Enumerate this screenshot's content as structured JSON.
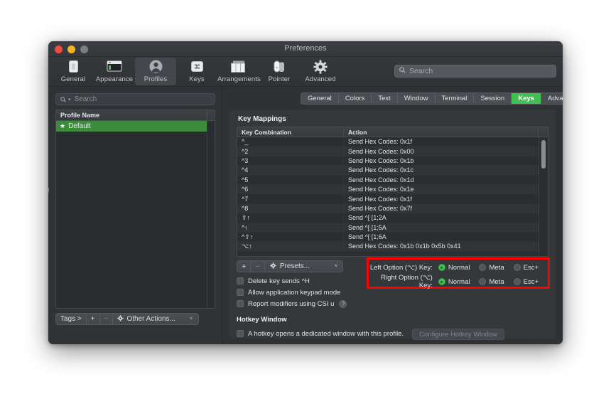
{
  "window": {
    "title": "Preferences",
    "traffic_lights": [
      "close-red",
      "minimize-yellow",
      "zoom-gray"
    ]
  },
  "toolbar": {
    "items": [
      {
        "label": "General",
        "icon": "general-icon",
        "active": false
      },
      {
        "label": "Appearance",
        "icon": "appearance-icon",
        "active": false
      },
      {
        "label": "Profiles",
        "icon": "profiles-icon",
        "active": true
      },
      {
        "label": "Keys",
        "icon": "keys-icon",
        "active": false
      },
      {
        "label": "Arrangements",
        "icon": "arrangements-icon",
        "active": false
      },
      {
        "label": "Pointer",
        "icon": "pointer-icon",
        "active": false
      },
      {
        "label": "Advanced",
        "icon": "advanced-icon",
        "active": false
      }
    ],
    "search_placeholder": "Search"
  },
  "sidebar": {
    "search_placeholder": "Search",
    "column_header": "Profile Name",
    "profiles": [
      {
        "name": "Default",
        "starred": true,
        "selected": true
      }
    ],
    "footer": {
      "tags_label": "Tags >",
      "add_label": "+",
      "remove_label": "−",
      "other_actions_label": "Other Actions...",
      "chevron": "˅"
    }
  },
  "main": {
    "tabs": [
      {
        "label": "General",
        "active": false
      },
      {
        "label": "Colors",
        "active": false
      },
      {
        "label": "Text",
        "active": false
      },
      {
        "label": "Window",
        "active": false
      },
      {
        "label": "Terminal",
        "active": false
      },
      {
        "label": "Session",
        "active": false
      },
      {
        "label": "Keys",
        "active": true
      },
      {
        "label": "Advanced",
        "active": false
      }
    ],
    "section_title": "Key Mappings",
    "table": {
      "columns": [
        "Key Combination",
        "Action"
      ],
      "rows": [
        {
          "key": "^_",
          "action": "Send Hex Codes: 0x1f"
        },
        {
          "key": "^2",
          "action": "Send Hex Codes: 0x00"
        },
        {
          "key": "^3",
          "action": "Send Hex Codes: 0x1b"
        },
        {
          "key": "^4",
          "action": "Send Hex Codes: 0x1c"
        },
        {
          "key": "^5",
          "action": "Send Hex Codes: 0x1d"
        },
        {
          "key": "^6",
          "action": "Send Hex Codes: 0x1e"
        },
        {
          "key": "^7",
          "action": "Send Hex Codes: 0x1f"
        },
        {
          "key": "^8",
          "action": "Send Hex Codes: 0x7f"
        },
        {
          "key": "⇧↑",
          "action": "Send ^[ [1;2A"
        },
        {
          "key": "^↑",
          "action": "Send ^[ [1;5A"
        },
        {
          "key": "^⇧↑",
          "action": "Send ^[ [1;6A"
        },
        {
          "key": "⌥↑",
          "action": "Send Hex Codes: 0x1b 0x1b 0x5b 0x41"
        }
      ]
    },
    "presets_bar": {
      "add_label": "+",
      "remove_label": "−",
      "presets_label": "Presets...",
      "chevron": "˅"
    },
    "checkboxes": [
      {
        "label": "Delete key sends ^H",
        "checked": false,
        "help": false
      },
      {
        "label": "Allow application keypad mode",
        "checked": false,
        "help": false
      },
      {
        "label": "Report modifiers using CSI u",
        "checked": false,
        "help": true,
        "help_glyph": "?"
      }
    ],
    "option_keys": {
      "highlight_color": "#ff0000",
      "rows": [
        {
          "label": "Left Option (⌥) Key:",
          "options": [
            {
              "label": "Normal",
              "selected": true
            },
            {
              "label": "Meta",
              "selected": false
            },
            {
              "label": "Esc+",
              "selected": false
            }
          ]
        },
        {
          "label": "Right Option (⌥) Key:",
          "options": [
            {
              "label": "Normal",
              "selected": true
            },
            {
              "label": "Meta",
              "selected": false
            },
            {
              "label": "Esc+",
              "selected": false
            }
          ]
        }
      ]
    },
    "hotkey": {
      "title": "Hotkey Window",
      "checkbox_label": "A hotkey opens a dedicated window with this profile.",
      "checked": false,
      "button_label": "Configure Hotkey Window",
      "button_disabled": true
    }
  },
  "colors": {
    "accent_green": "#3fc14f",
    "selection_green": "#3d8b3d",
    "highlight_red": "#ff0000",
    "window_bg": "#2f3235",
    "panel_bg": "#35383b"
  }
}
